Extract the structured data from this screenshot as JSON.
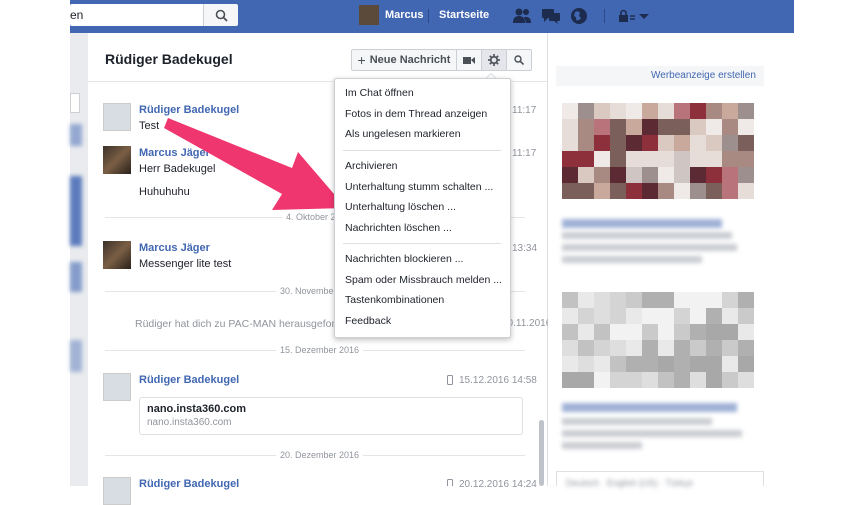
{
  "topbar": {
    "search_text": "en",
    "user_name": "Marcus",
    "home_label": "Startseite",
    "icons": [
      "friends-icon",
      "messages-icon",
      "notifications-globe-icon",
      "privacy-lock-icon",
      "caret-down-icon"
    ]
  },
  "conversation": {
    "title": "Rüdiger Badekugel",
    "new_message_label": "Neue Nachricht",
    "messages": [
      {
        "sender": "Rüdiger Badekugel",
        "lines": [
          "Test"
        ],
        "time": "11:17"
      },
      {
        "sender": "Marcus Jäger",
        "lines": [
          "Herr Badekugel",
          "Huhuhuhu"
        ],
        "time": "11:17"
      },
      {
        "day": "4. Oktober 2016"
      },
      {
        "sender": "Marcus Jäger",
        "lines": [
          "Messenger lite test"
        ],
        "time": "13:34"
      },
      {
        "day": "30. November 2016"
      },
      {
        "system": "Rüdiger hat dich zu PAC-MAN herausgefordert.",
        "time": "30.11.2016"
      },
      {
        "day": "15. Dezember 2016"
      },
      {
        "sender": "Rüdiger Badekugel",
        "time": "15.12.2016 14:58",
        "link_title": "nano.insta360.com",
        "link_url": "nano.insta360.com"
      },
      {
        "day": "20. Dezember 2016"
      },
      {
        "sender": "Rüdiger Badekugel",
        "time": "20.12.2016 14:24"
      }
    ]
  },
  "dropdown": {
    "items": [
      "Im Chat öffnen",
      "Fotos in dem Thread anzeigen",
      "Als ungelesen markieren",
      "Archivieren",
      "Unterhaltung stumm schalten ...",
      "Unterhaltung löschen ...",
      "Nachrichten löschen ...",
      "Nachrichten blockieren ...",
      "Spam oder Missbrauch melden ...",
      "Tastenkombinationen",
      "Feedback"
    ]
  },
  "ads": {
    "create_label": "Werbeanzeige erstellen",
    "footer_text": "Deutsch · English (US) · Türkçe"
  },
  "colors": {
    "brand_blue": "#4267b2",
    "arrow_pink": "#f0366f"
  }
}
